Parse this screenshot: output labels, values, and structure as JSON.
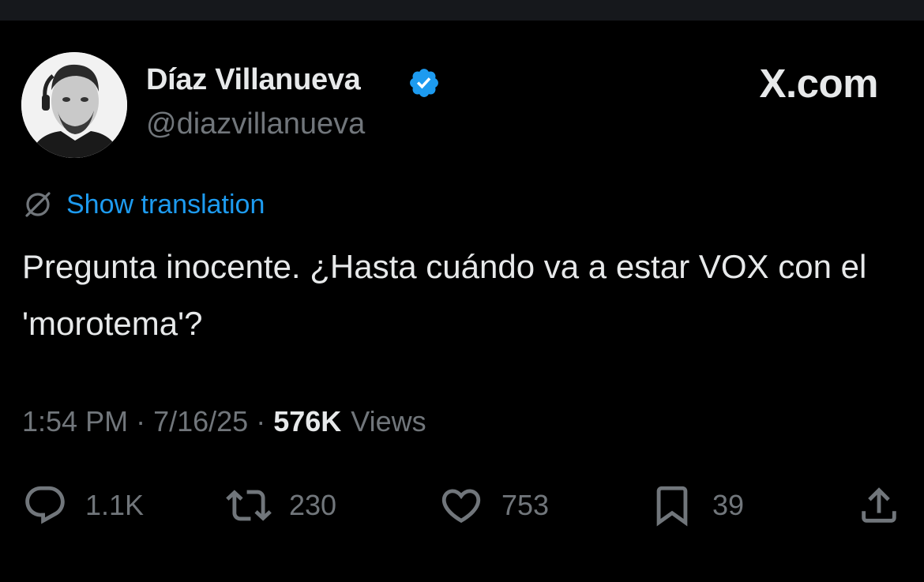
{
  "author": {
    "display_name": "Díaz Villanueva",
    "handle": "@diazvillanueva",
    "verified": true
  },
  "brand": "X.com",
  "translation": {
    "label": "Show translation"
  },
  "tweet": {
    "text": "Pregunta inocente. ¿Hasta cuándo va a estar VOX con el 'morotema'?"
  },
  "meta": {
    "time": "1:54 PM",
    "separator": "·",
    "date": "7/16/25",
    "views_count": "576K",
    "views_label": "Views"
  },
  "actions": {
    "replies": "1.1K",
    "reposts": "230",
    "likes": "753",
    "bookmarks": "39"
  },
  "colors": {
    "background": "#000000",
    "text": "#e7e9ea",
    "secondary": "#71767b",
    "accent": "#1d9bf0"
  },
  "icons": [
    "verified-badge-icon",
    "translate-icon",
    "reply-icon",
    "repost-icon",
    "like-icon",
    "bookmark-icon",
    "share-icon"
  ]
}
